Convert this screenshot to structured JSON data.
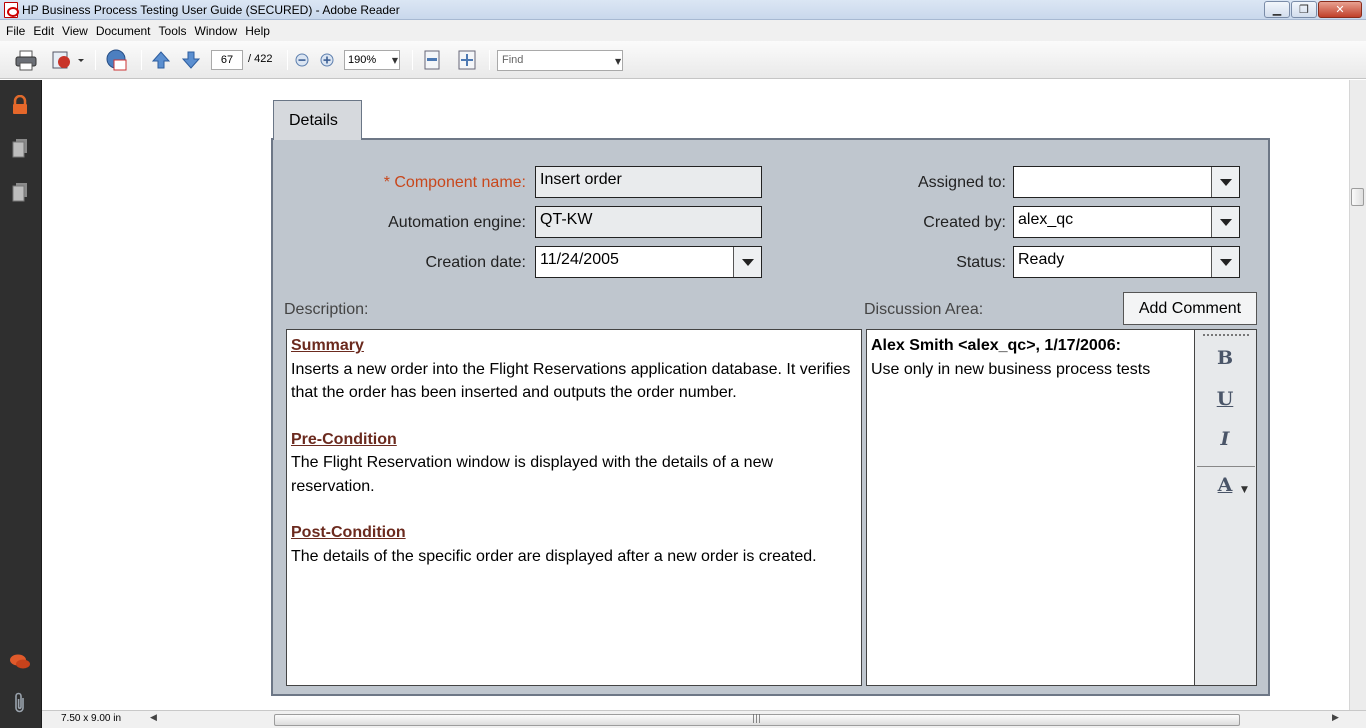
{
  "window": {
    "title": "HP Business Process Testing User Guide (SECURED) - Adobe Reader",
    "controls": {
      "minimize": "▁",
      "maximize": "❐",
      "close": "✕"
    }
  },
  "menu": [
    "File",
    "Edit",
    "View",
    "Document",
    "Tools",
    "Window",
    "Help"
  ],
  "toolbar": {
    "current_page": "67",
    "page_count": "/ 422",
    "zoom": "190%",
    "find_placeholder": "Find"
  },
  "status": {
    "page_size": "7.50 x 9.00 in"
  },
  "figure": {
    "tab_label": "Details",
    "fields": {
      "component_name_label": "* Component name:",
      "component_name_value": "Insert order",
      "automation_engine_label": "Automation engine:",
      "automation_engine_value": "QT-KW",
      "creation_date_label": "Creation date:",
      "creation_date_value": "11/24/2005",
      "assigned_to_label": "Assigned to:",
      "assigned_to_value": "",
      "created_by_label": "Created by:",
      "created_by_value": "alex_qc",
      "status_label": "Status:",
      "status_value": "Ready"
    },
    "description_label": "Description:",
    "discussion_label": "Discussion Area:",
    "add_comment_label": "Add Comment",
    "description": {
      "summary_heading": "Summary",
      "summary_text": "Inserts a new order into the  Flight Reservations application database. It verifies that the order has been inserted and outputs the order number.",
      "precondition_heading": "Pre-Condition",
      "precondition_text": "The Flight Reservation window is displayed with the details of a new reservation.",
      "postcondition_heading": "Post-Condition",
      "postcondition_text": "The details of the specific order are displayed after a new order is created."
    },
    "discussion": {
      "author": "Alex Smith <alex_qc>, 1/17/2006:",
      "comment": "Use only in new business process tests"
    },
    "format_buttons": {
      "bold": "B",
      "underline": "U",
      "italic": "I",
      "font_color": "A"
    }
  }
}
